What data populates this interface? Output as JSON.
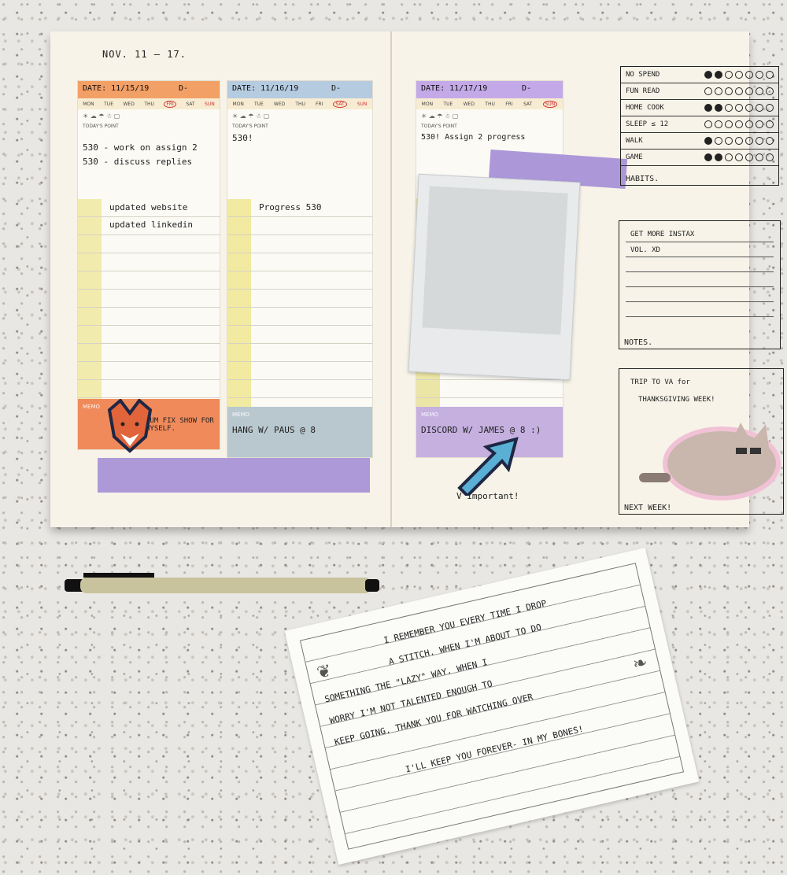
{
  "planner": {
    "week_label": "NOV. 11 — 17.",
    "days": [
      "MON",
      "TUE",
      "WED",
      "THU",
      "FRI",
      "SAT",
      "SUN"
    ],
    "todays_point_label": "TODAY'S POINT",
    "memo_label": "MEMO",
    "day1": {
      "date": "DATE: 11/15/19",
      "d_label": "D-",
      "highlight_day": "FRI",
      "points": [
        "530 - work on assign 2",
        "530 - discuss replies"
      ],
      "tasks": [
        "updated website",
        "updated linkedin"
      ],
      "memo": "UUM FIX SHOW FOR MYSELF."
    },
    "day2": {
      "date": "DATE: 11/16/19",
      "d_label": "D-",
      "highlight_day": "SAT",
      "points": [
        "530!"
      ],
      "tasks": [
        "Progress 530"
      ],
      "memo": "HANG W/ PAUS @ 8"
    },
    "day3": {
      "date": "DATE: 11/17/19",
      "d_label": "D-",
      "highlight_day": "SUN",
      "points": [
        "530! Assign 2 progress"
      ],
      "memo": "DISCORD W/ JAMES @ 8 :)",
      "footnote": "V important!"
    },
    "habits": {
      "label": "HABITS.",
      "items": [
        {
          "name": "NO SPEND",
          "filled": 2
        },
        {
          "name": "FUN READ",
          "filled": 0
        },
        {
          "name": "HOME COOK",
          "filled": 2
        },
        {
          "name": "SLEEP ≤ 12",
          "filled": 0
        },
        {
          "name": "WALK",
          "filled": 1
        },
        {
          "name": "GAME",
          "filled": 2
        }
      ],
      "dots_per_row": 7
    },
    "notes": {
      "label": "NOTES.",
      "lines": [
        "GET MORE INSTAX",
        "VOL. XD"
      ]
    },
    "next_week": {
      "label": "NEXT WEEK!",
      "lines": [
        "TRIP TO VA for",
        "THANKSGIVING WEEK!"
      ]
    }
  },
  "card": {
    "lines": [
      "I REMEMBER YOU EVERY TIME I DROP",
      "A STITCH. WHEN I'M ABOUT TO DO",
      "SOMETHING THE \"LAZY\" WAY. WHEN I",
      "WORRY I'M NOT TALENTED ENOUGH TO",
      "KEEP GOING. THANK YOU FOR WATCHING OVER",
      "I'LL KEEP YOU FOREVER- IN MY BONES!"
    ]
  },
  "colors": {
    "tape": "#a58fd6",
    "memo_orange": "#f08a5a",
    "memo_blue": "#b9c8cf",
    "memo_purple": "#c5b0e0",
    "date_orange": "#f3a066",
    "date_blue": "#b5cbe0",
    "date_purple": "#c4a9e8"
  }
}
